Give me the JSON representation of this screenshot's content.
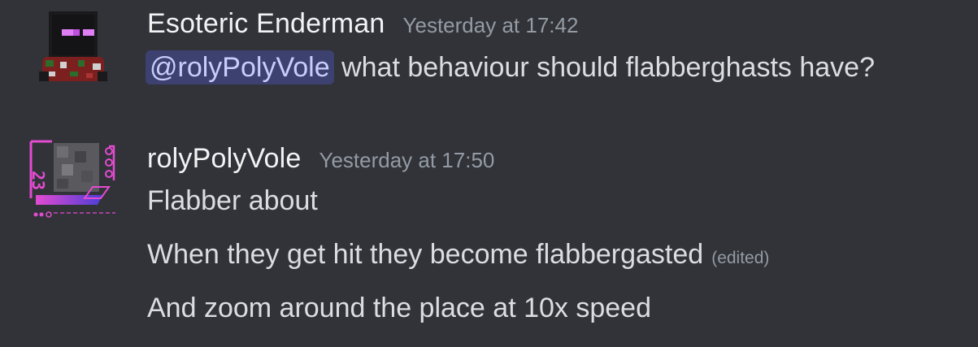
{
  "messages": [
    {
      "author": "Esoteric Enderman",
      "timestamp": "Yesterday at 17:42",
      "avatar_icon": "enderman-avatar-icon",
      "mention": "@rolyPolyVole",
      "text": "what behaviour should flabberghasts have?"
    },
    {
      "author": "rolyPolyVole",
      "timestamp": "Yesterday at 17:50",
      "avatar_icon": "cyber-avatar-icon",
      "lines": [
        "Flabber about",
        "When they get hit they become flabbergasted",
        "And zoom around the place at 10x speed"
      ],
      "edited_label": "(edited)"
    }
  ],
  "colors": {
    "background": "#313338",
    "username": "#f2f3f5",
    "timestamp": "#949ba4",
    "text": "#dbdee1",
    "mention_bg": "#3c4270",
    "mention_text": "#c9cdfb",
    "avatar_accent": "#e34bd0"
  }
}
